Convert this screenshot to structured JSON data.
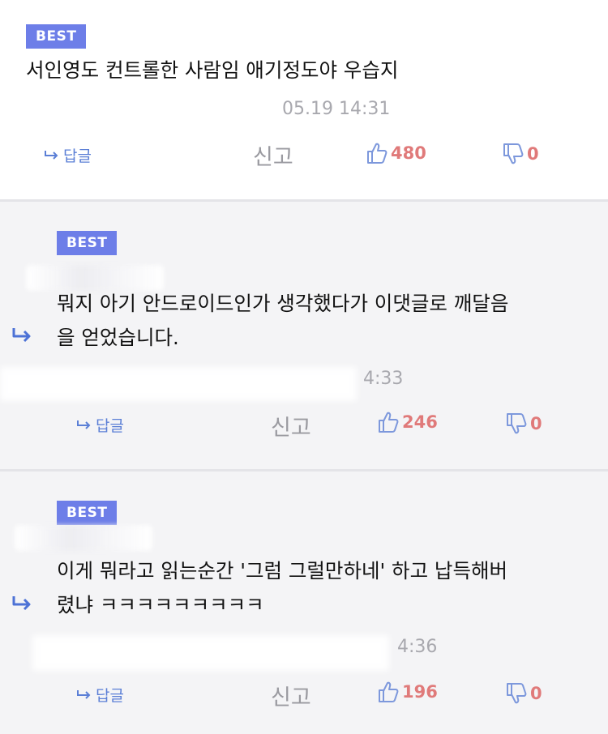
{
  "comments": [
    {
      "badge": "BEST",
      "text_lines": [
        "서인영도 컨트롤한 사람임 애기정도야 우습지"
      ],
      "timestamp": "05.19 14:31",
      "reply_label": "답글",
      "report_label": "신고",
      "likes": "480",
      "dislikes": "0"
    },
    {
      "badge": "BEST",
      "text_lines": [
        "뭐지 아기 안드로이드인가 생각했다가 이댓글로 깨달음",
        "을 얻었습니다."
      ],
      "timestamp": "4:33",
      "reply_label": "답글",
      "report_label": "신고",
      "likes": "246",
      "dislikes": "0"
    },
    {
      "badge": "BEST",
      "text_lines": [
        "이게 뭐라고 읽는순간 '그럼 그럴만하네' 하고 납득해버",
        "렸냐 ㅋㅋㅋㅋㅋㅋㅋㅋㅋ"
      ],
      "timestamp": "4:36",
      "reply_label": "답글",
      "report_label": "신고",
      "likes": "196",
      "dislikes": "0"
    }
  ],
  "colors": {
    "badge": "#6d7ee8",
    "reply": "#5b7fd6",
    "count": "#e07a7a",
    "thumb": "#7d98dc",
    "muted": "#9a9aa0"
  }
}
